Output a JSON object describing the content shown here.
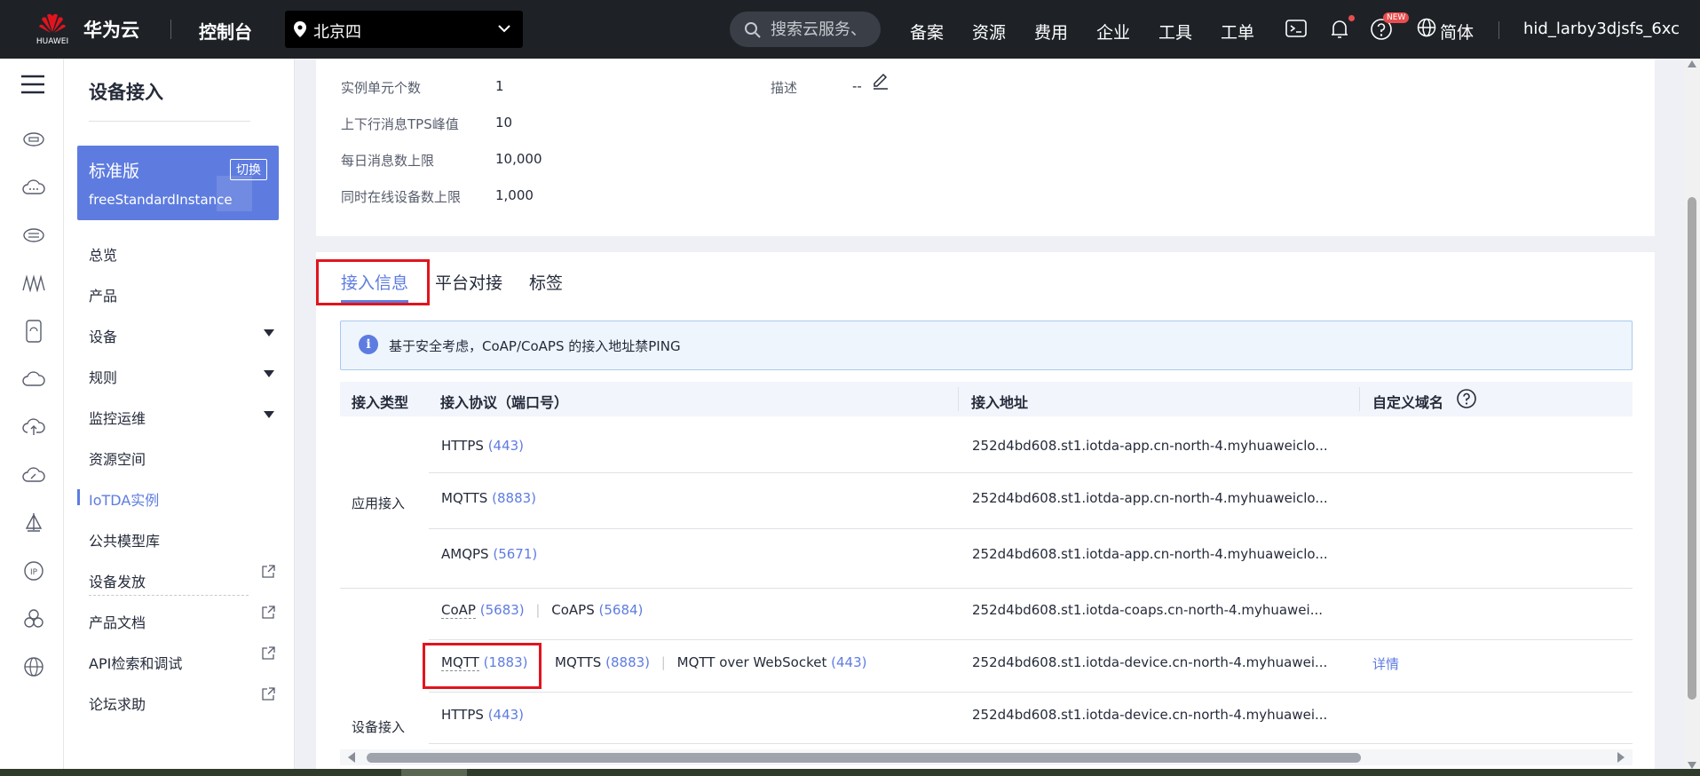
{
  "topbar": {
    "logo_text": "HUAWEI",
    "cloud_name": "华为云",
    "console": "控制台",
    "region": "北京四",
    "search_placeholder": "搜索云服务、",
    "nav": [
      "备案",
      "资源",
      "费用",
      "企业",
      "工具",
      "工单"
    ],
    "new_badge": "NEW",
    "language": "简体",
    "username": "hid_larby3djsfs_6xc",
    "accent": "#5e7ce0"
  },
  "sidebar": {
    "title": "设备接入",
    "edition": "标准版",
    "switch_label": "切换",
    "instance": "freeStandardInstance",
    "items": {
      "overview": "总览",
      "product": "产品",
      "device": "设备",
      "rules": "规则",
      "monitoring": "监控运维",
      "resource_space": "资源空间",
      "iotda_instance": "IoTDA实例",
      "public_models": "公共模型库",
      "provisioning": "设备发放",
      "product_docs": "产品文档",
      "api_explorer": "API检索和调试",
      "forum": "论坛求助"
    }
  },
  "info": {
    "unit_count_label": "实例单元个数",
    "unit_count": "1",
    "description_label": "描述",
    "description": "--",
    "tps_label": "上下行消息TPS峰值",
    "tps": "10",
    "daily_label": "每日消息数上限",
    "daily": "10,000",
    "online_label": "同时在线设备数上限",
    "online": "1,000"
  },
  "tabs": {
    "access_info": "接入信息",
    "platform": "平台对接",
    "tags": "标签"
  },
  "notice": "基于安全考虑，CoAP/CoAPS 的接入地址禁PING",
  "table": {
    "headers": {
      "type": "接入类型",
      "protocol": "接入协议（端口号）",
      "address": "接入地址",
      "domain": "自定义域名"
    },
    "app_type": "应用接入",
    "device_type": "设备接入",
    "rows": [
      {
        "p1": "HTTPS",
        "p1_port": "(443)",
        "address": "252d4bd608.st1.iotda-app.cn-north-4.myhuaweiclo..."
      },
      {
        "p1": "MQTTS",
        "p1_port": "(8883)",
        "address": "252d4bd608.st1.iotda-app.cn-north-4.myhuaweiclo..."
      },
      {
        "p1": "AMQPS",
        "p1_port": "(5671)",
        "address": "252d4bd608.st1.iotda-app.cn-north-4.myhuaweiclo..."
      },
      {
        "p1": "CoAP",
        "p1_port": "(5683)",
        "p2": "CoAPS",
        "p2_port": "(5684)",
        "address": "252d4bd608.st1.iotda-coaps.cn-north-4.myhuawei..."
      },
      {
        "p1": "MQTT",
        "p1_port": "(1883)",
        "p2": "MQTTS",
        "p2_port": "(8883)",
        "p3": "MQTT over WebSocket",
        "p3_port": "(443)",
        "address": "252d4bd608.st1.iotda-device.cn-north-4.myhuawei...",
        "domain_link": "详情"
      },
      {
        "p1": "HTTPS",
        "p1_port": "(443)",
        "address": "252d4bd608.st1.iotda-device.cn-north-4.myhuawei..."
      }
    ]
  }
}
